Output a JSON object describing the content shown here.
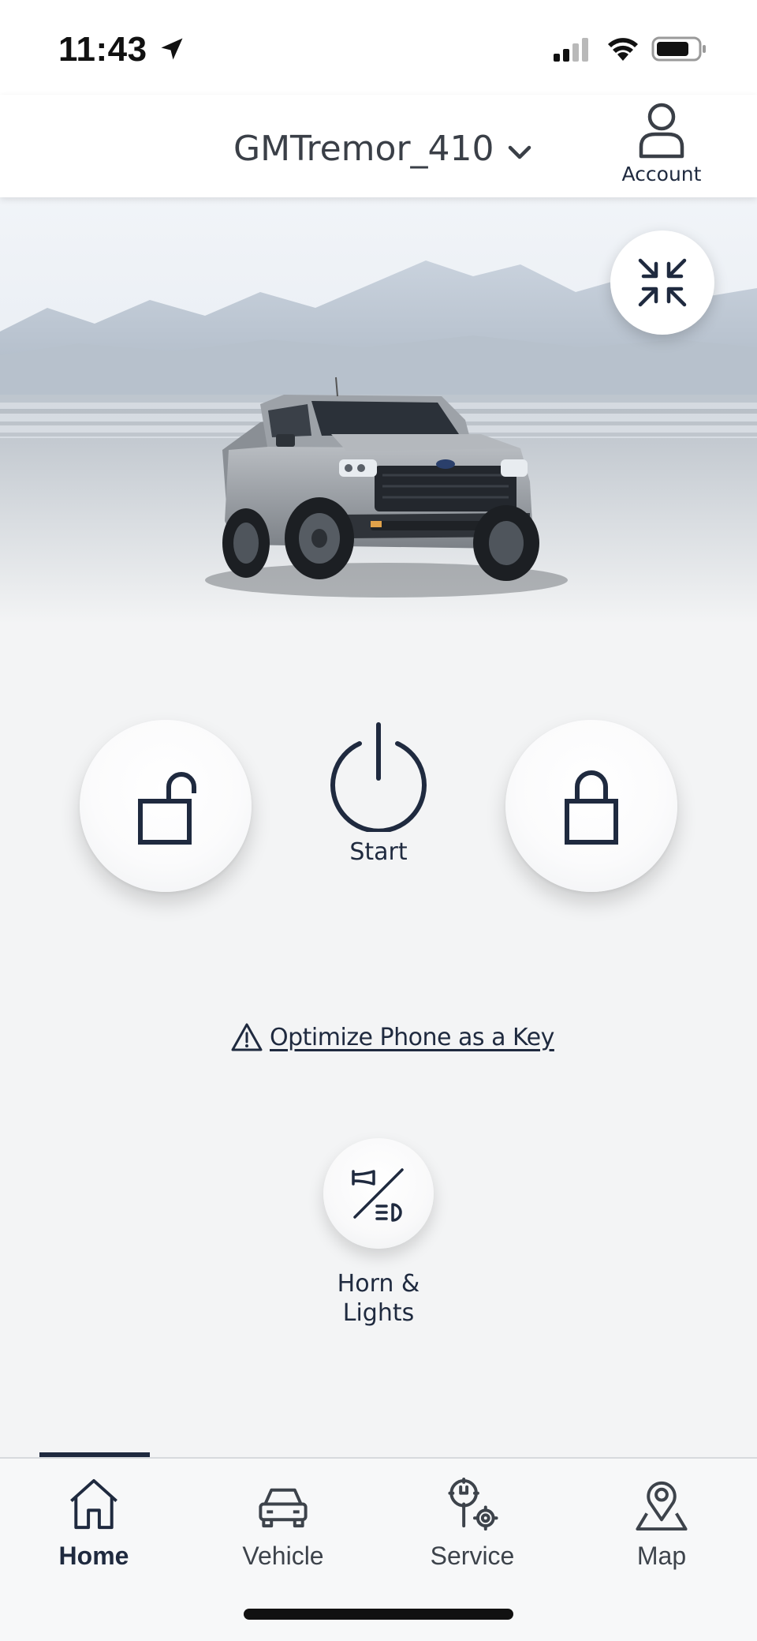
{
  "status_bar": {
    "time": "11:43",
    "location_icon": "location-arrow-icon",
    "signal_icon": "cellular-signal-icon",
    "wifi_icon": "wifi-icon",
    "battery_icon": "battery-icon"
  },
  "header": {
    "vehicle_name": "GMTremor_410",
    "dropdown_icon": "chevron-down-icon",
    "account_label": "Account",
    "account_icon": "person-icon"
  },
  "hero": {
    "image": "pickup-truck-image",
    "collapse_icon": "collapse-arrows-icon"
  },
  "controls": {
    "unlock_icon": "unlock-icon",
    "start_label": "Start",
    "start_icon": "power-icon",
    "lock_icon": "lock-icon"
  },
  "optimize_link": {
    "text": "Optimize Phone as a Key",
    "icon": "warning-icon"
  },
  "horn_lights": {
    "label_line1": "Horn &",
    "label_line2": "Lights",
    "icon": "horn-lights-icon"
  },
  "bottom_nav": {
    "active": "Home",
    "items": [
      {
        "label": "Home",
        "icon": "home-icon"
      },
      {
        "label": "Vehicle",
        "icon": "car-icon"
      },
      {
        "label": "Service",
        "icon": "wrench-gear-icon"
      },
      {
        "label": "Map",
        "icon": "map-pin-icon"
      }
    ]
  },
  "colors": {
    "navy": "#1f2a3f",
    "background": "#f3f4f5",
    "header_bg": "#ffffff"
  }
}
